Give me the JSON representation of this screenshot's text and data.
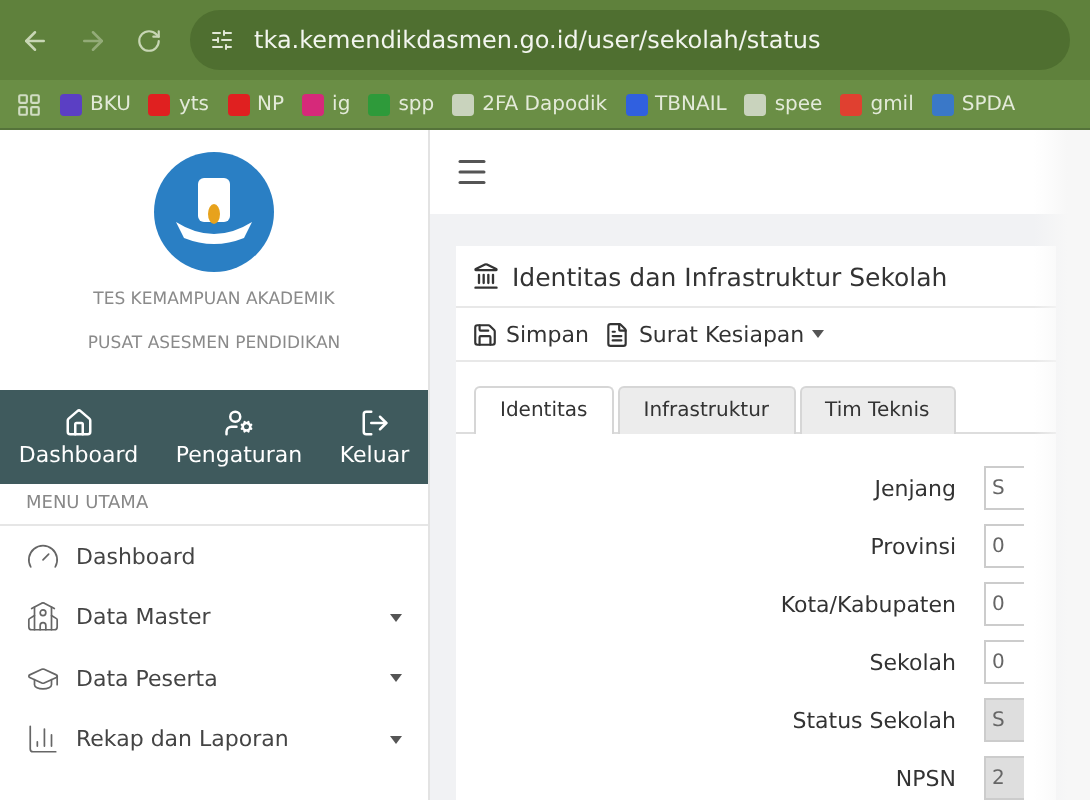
{
  "browser": {
    "url": "tka.kemendikdasmen.go.id/user/sekolah/status",
    "bookmarks": [
      {
        "label": "BKU",
        "color": "#5b3fc4"
      },
      {
        "label": "yts",
        "color": "#e02020"
      },
      {
        "label": "NP",
        "color": "#e02020"
      },
      {
        "label": "ig",
        "color": "#d6297a"
      },
      {
        "label": "spp",
        "color": "#2e9a3a"
      },
      {
        "label": "2FA Dapodik",
        "color": "#c9d3bd"
      },
      {
        "label": "TBNAIL",
        "color": "#3060e0"
      },
      {
        "label": "spee",
        "color": "#c9d3bd"
      },
      {
        "label": "gmil",
        "color": "#e04030"
      },
      {
        "label": "SPDA",
        "color": "#3a78c8"
      }
    ]
  },
  "sidebar": {
    "org_lines": [
      "TES KEMAMPUAN AKADEMIK",
      "PUSAT ASESMEN PENDIDIKAN"
    ],
    "quick_buttons": [
      {
        "kind": "home",
        "label": "Dashboard"
      },
      {
        "kind": "settings",
        "label": "Pengaturan"
      },
      {
        "kind": "logout",
        "label": "Keluar"
      }
    ],
    "section": "MENU UTAMA",
    "items": [
      {
        "kind": "gauge",
        "label": "Dashboard",
        "expandable": false
      },
      {
        "kind": "building",
        "label": "Data Master",
        "expandable": true
      },
      {
        "kind": "student",
        "label": "Data Peserta",
        "expandable": true
      },
      {
        "kind": "chart",
        "label": "Rekap dan Laporan",
        "expandable": true
      }
    ]
  },
  "card": {
    "title": "Identitas dan Infrastruktur Sekolah",
    "actions": [
      {
        "kind": "save",
        "label": "Simpan",
        "dropdown": false
      },
      {
        "kind": "pdf",
        "label": "Surat Kesiapan",
        "dropdown": true
      }
    ],
    "tabs": [
      {
        "label": "Identitas",
        "selected": true
      },
      {
        "label": "Infrastruktur",
        "selected": false
      },
      {
        "label": "Tim Teknis",
        "selected": false
      }
    ],
    "fields": [
      {
        "label": "Jenjang",
        "value": "S",
        "disabled": false
      },
      {
        "label": "Provinsi",
        "value": "0",
        "disabled": false
      },
      {
        "label": "Kota/Kabupaten",
        "value": "0",
        "disabled": false
      },
      {
        "label": "Sekolah",
        "value": "0",
        "disabled": false
      },
      {
        "label": "Status Sekolah",
        "value": "S",
        "disabled": true
      },
      {
        "label": "NPSN",
        "value": "2",
        "disabled": true
      }
    ]
  }
}
